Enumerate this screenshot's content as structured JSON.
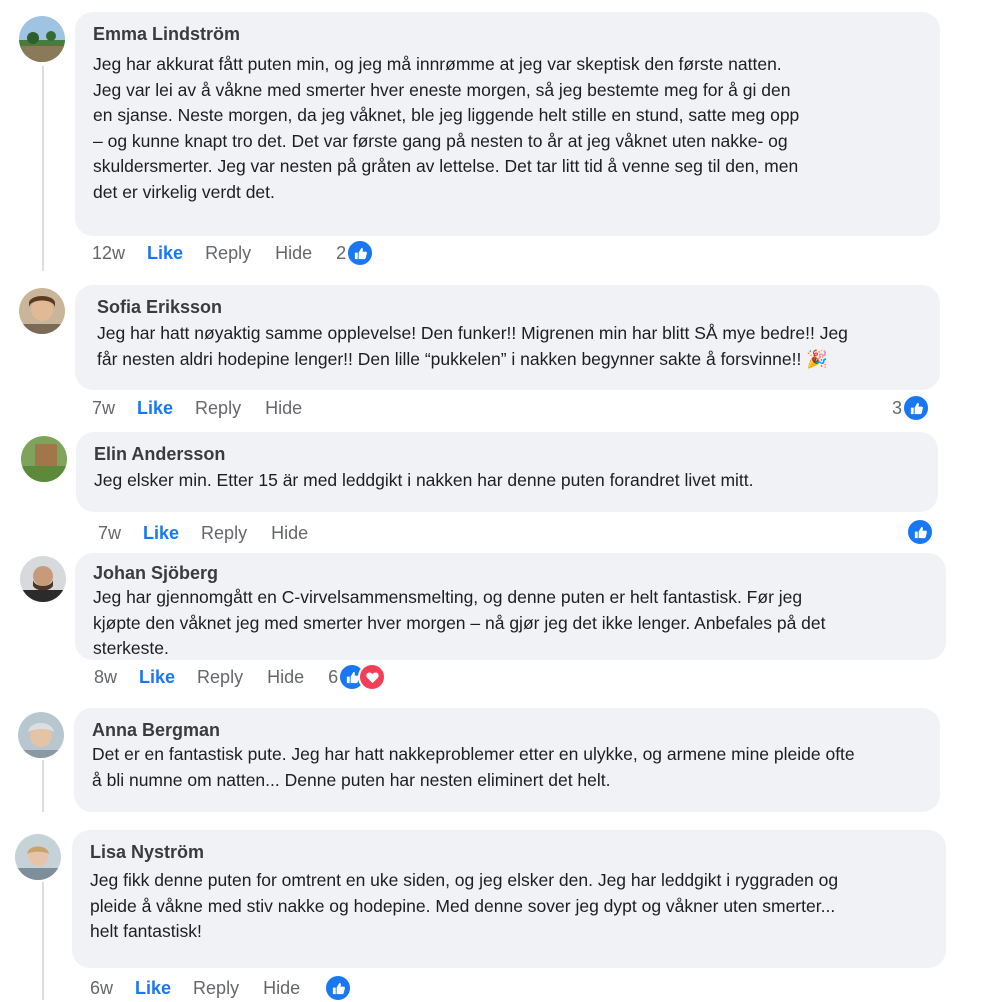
{
  "comments": [
    {
      "author": "Emma Lindström",
      "text": "Jeg har akkurat fått puten min, og jeg må innrømme at jeg var skeptisk den første natten.\nJeg var lei av å våkne med smerter hver eneste morgen, så jeg bestemte meg for å gi den\nen sjanse. Neste morgen, da jeg våknet, ble jeg liggende helt stille en stund, satte meg opp\n– og kunne knapt tro det. Det var første gang på nesten to år at jeg våknet uten nakke- og\nskuldersmerter. Jeg var nesten på gråten av lettelse. Det tar litt tid å venne seg til den, men\ndet er virkelig verdt det.",
      "time": "12w",
      "reaction_count": "2"
    },
    {
      "author": "Sofia Eriksson",
      "text": "Jeg har hatt nøyaktig samme opplevelse! Den funker!! Migrenen min har blitt SÅ mye bedre!! Jeg\nfår nesten aldri hodepine lenger!! Den lille “pukkelen” i nakken begynner sakte å forsvinne!! 🎉",
      "time": "7w",
      "reaction_count": "3"
    },
    {
      "author": "Elin Andersson",
      "text": "Jeg elsker min. Etter 15 är med leddgikt i nakken har denne puten forandret livet mitt.",
      "time": "7w",
      "reaction_count": ""
    },
    {
      "author": "Johan Sjöberg",
      "text": "Jeg har gjennomgått en C-virvelsammensmelting, og denne puten er helt fantastisk. Før jeg\nkjøpte den våknet jeg med smerter hver morgen – nå gjør jeg det ikke lenger. Anbefales på det\nsterkeste.",
      "time": "8w",
      "reaction_count": "6"
    },
    {
      "author": "Anna Bergman",
      "text": "Det er en fantastisk pute. Jeg har hatt nakkeproblemer etter en ulykke, og armene mine pleide ofte\nå bli numne om natten... Denne puten har nesten eliminert det helt.",
      "time": "",
      "reaction_count": ""
    },
    {
      "author": "Lisa Nyström",
      "text": "Jeg fikk denne puten for omtrent en uke siden, og jeg elsker den. Jeg har leddgikt i ryggraden og\npleide å våkne med stiv nakke og hodepine. Med denne sover jeg dypt og våkner uten smerter...\nhelt fantastisk!",
      "time": "6w",
      "reaction_count": ""
    }
  ],
  "actions": {
    "like": "Like",
    "reply": "Reply",
    "hide": "Hide"
  },
  "icons": {
    "like_reaction": "thumbs-up-icon",
    "love_reaction": "heart-icon"
  },
  "colors": {
    "bubble": "#f0f2f5",
    "like_blue": "#1877f2",
    "love_red": "#f33e58",
    "meta_gray": "#65676b"
  }
}
